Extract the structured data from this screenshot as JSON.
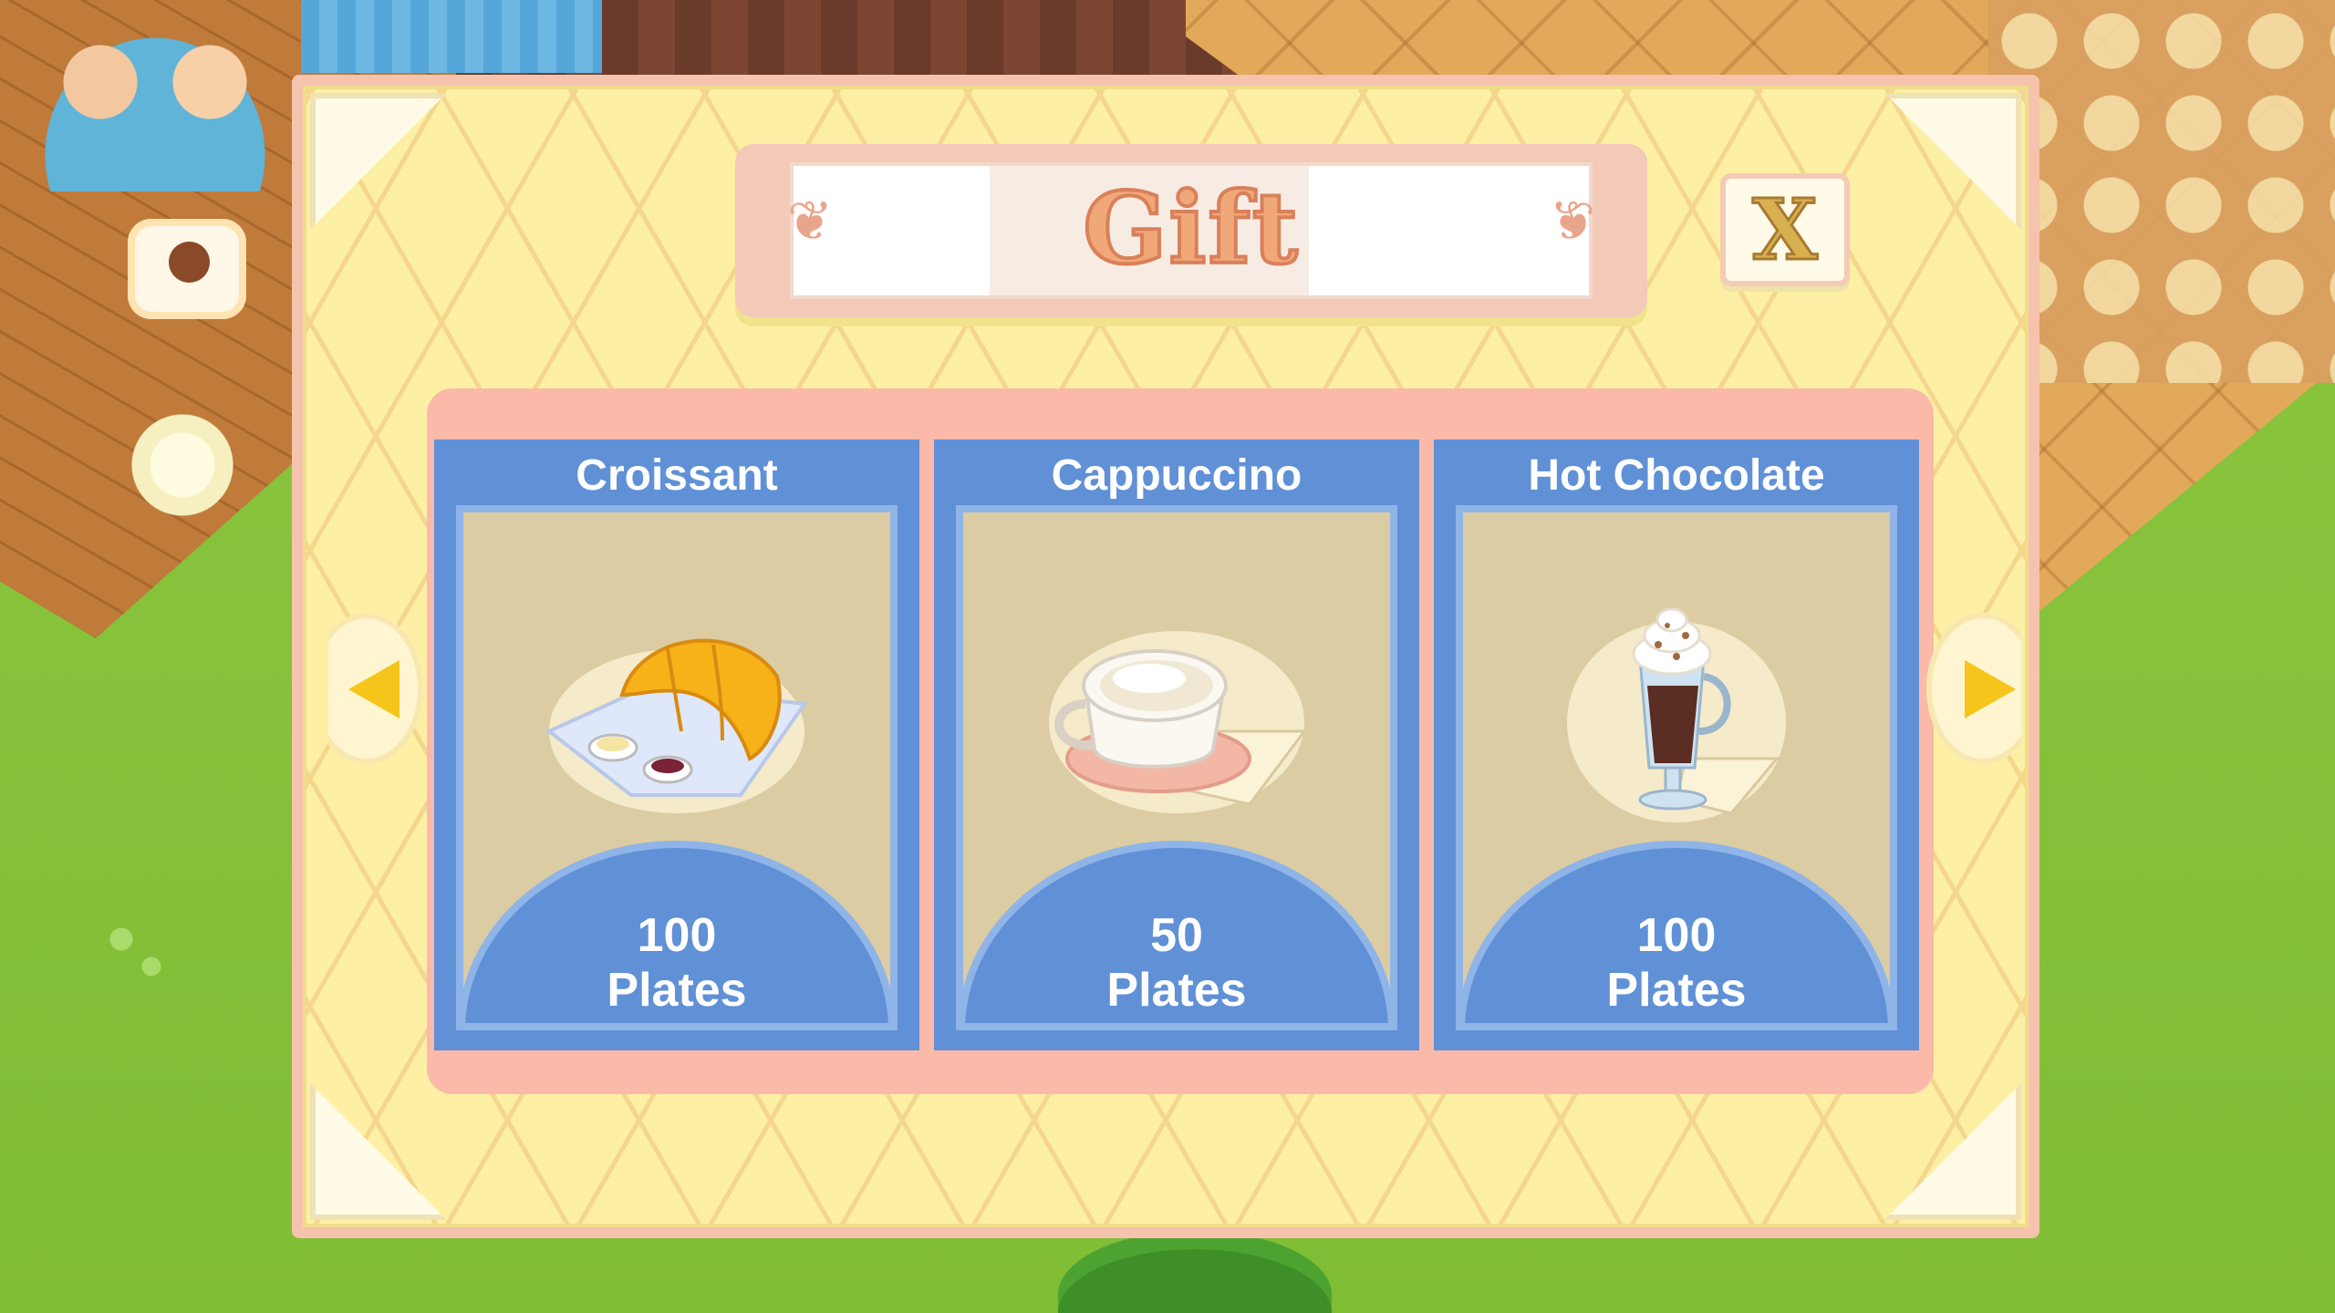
{
  "dialog": {
    "title": "Gift",
    "close_label": "X"
  },
  "navigation": {
    "prev_icon": "arrow-left-icon",
    "next_icon": "arrow-right-icon"
  },
  "items": [
    {
      "name": "Croissant",
      "amount": "100",
      "unit": "Plates",
      "icon": "croissant-plate-icon"
    },
    {
      "name": "Cappuccino",
      "amount": "50",
      "unit": "Plates",
      "icon": "cappuccino-cup-icon"
    },
    {
      "name": "Hot Chocolate",
      "amount": "100",
      "unit": "Plates",
      "icon": "hot-chocolate-glass-icon"
    }
  ],
  "colors": {
    "card_blue": "#6090d6",
    "panel_pink": "#fbb9a9",
    "dialog_yellow": "#fdf0a4",
    "arrow_yellow": "#f5c51c",
    "title_orange": "#f1a878"
  }
}
